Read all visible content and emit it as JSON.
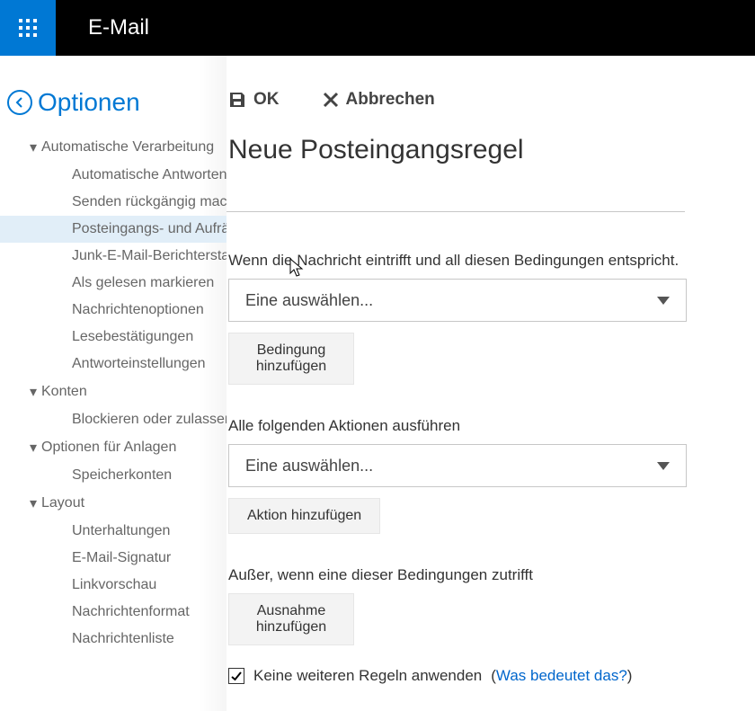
{
  "header": {
    "app_title": "E-Mail"
  },
  "sidebar": {
    "back_label": "Optionen",
    "sections": [
      {
        "label": "Automatische Verarbeitung",
        "items": [
          "Automatische Antworten",
          "Senden rückgängig machen",
          "Posteingangs- und Aufräumregeln",
          "Junk-E-Mail-Berichterstattung",
          "Als gelesen markieren",
          "Nachrichtenoptionen",
          "Lesebestätigungen",
          "Antworteinstellungen"
        ],
        "selected_index": 2
      },
      {
        "label": "Konten",
        "items": [
          "Blockieren oder zulassen"
        ]
      },
      {
        "label": "Optionen für Anlagen",
        "items": [
          "Speicherkonten"
        ]
      },
      {
        "label": "Layout",
        "items": [
          "Unterhaltungen",
          "E-Mail-Signatur",
          "Linkvorschau",
          "Nachrichtenformat",
          "Nachrichtenliste"
        ]
      }
    ]
  },
  "toolbar": {
    "ok_label": "OK",
    "cancel_label": "Abbrechen"
  },
  "page": {
    "title": "Neue Posteingangsregel",
    "rule_name_value": "",
    "sections": {
      "conditions": {
        "label": "Wenn die Nachricht eintrifft und all diesen Bedingungen entspricht.",
        "dropdown_placeholder": "Eine auswählen...",
        "add_btn": "Bedingung hinzufügen"
      },
      "actions": {
        "label": "Alle folgenden Aktionen ausführen",
        "dropdown_placeholder": "Eine auswählen...",
        "add_btn": "Aktion hinzufügen"
      },
      "exceptions": {
        "label": "Außer, wenn eine dieser Bedingungen zutrifft",
        "add_btn": "Ausnahme hinzufügen"
      }
    },
    "stop_rules": {
      "checked": true,
      "label": "Keine weiteren Regeln anwenden",
      "help_prefix": "(",
      "help_link": "Was bedeutet das?",
      "help_suffix": ")"
    }
  }
}
